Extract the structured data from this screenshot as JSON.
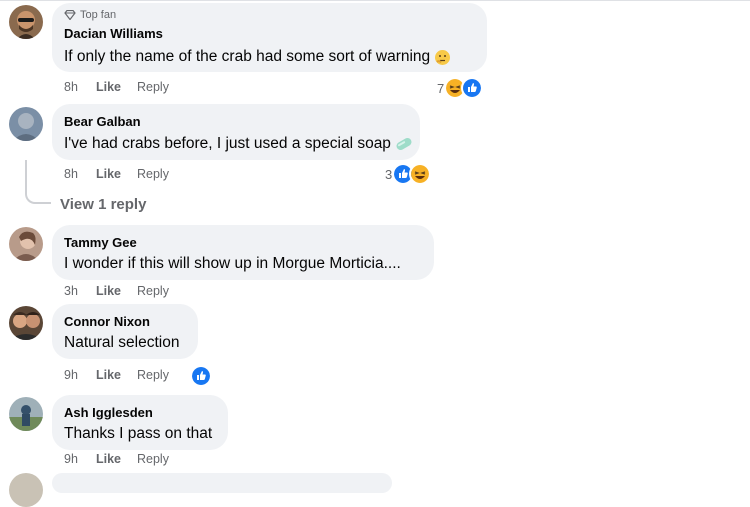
{
  "comments": [
    {
      "badge": "Top fan",
      "author": "Dacian Williams",
      "text": "If only the name of the crab had some sort of warning",
      "text_emoji": "thinking-face",
      "time": "8h",
      "like": "Like",
      "reply": "Reply",
      "reaction_count": "7",
      "reactions": [
        "haha",
        "like"
      ]
    },
    {
      "author": "Bear Galban",
      "text": "I've had crabs before, I just used a special soap",
      "text_emoji": "soap",
      "time": "8h",
      "like": "Like",
      "reply": "Reply",
      "reaction_count": "3",
      "reactions": [
        "like",
        "haha"
      ],
      "view_replies": "View 1 reply"
    },
    {
      "author": "Tammy Gee",
      "text": "I wonder if this will show up in Morgue Morticia....",
      "time": "3h",
      "like": "Like",
      "reply": "Reply"
    },
    {
      "author": "Connor Nixon",
      "text": "Natural selection",
      "time": "9h",
      "like": "Like",
      "reply": "Reply",
      "reactions": [
        "like"
      ]
    },
    {
      "author": "Ash Igglesden",
      "text": "Thanks I pass on that",
      "time": "9h",
      "like": "Like",
      "reply": "Reply"
    }
  ],
  "colors": {
    "bubble": "#f0f2f5",
    "like_blue": "#1877f2",
    "haha_yellow": "#f7b125",
    "meta_gray": "#65676b"
  }
}
